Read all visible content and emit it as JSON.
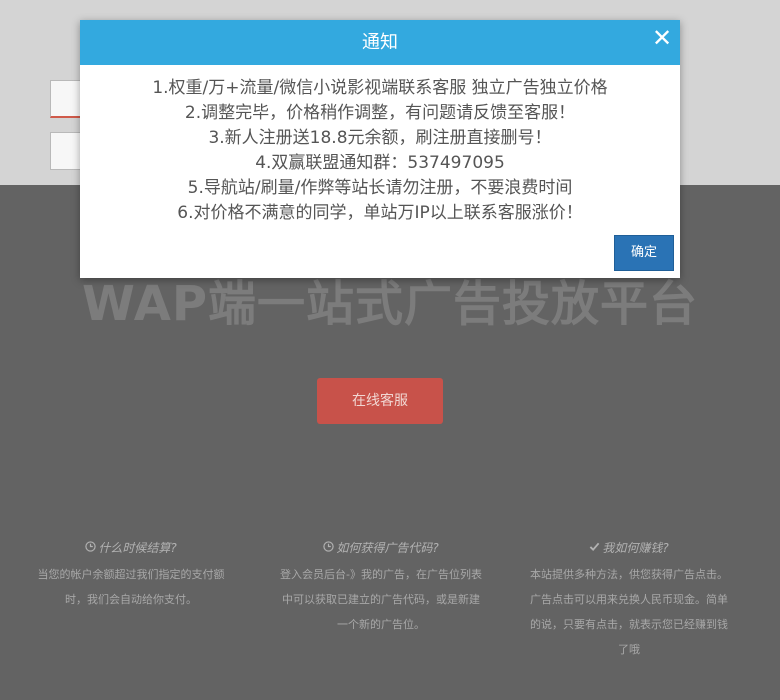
{
  "hero": {
    "title": "WAP端一站式广告投放平台",
    "cs_button_label": "在线客服"
  },
  "faq": [
    {
      "icon": "clock-icon",
      "question": "什么时候结算?",
      "answer_lines": [
        "当您的帐户余额超过我们指定的支付额",
        "时，我们会自动给你支付。"
      ]
    },
    {
      "icon": "clock-icon",
      "question": "如何获得广告代码?",
      "answer_lines": [
        "登入会员后台-》我的广告，在广告位列表",
        "中可以获取已建立的广告代码，或是新建",
        "一个新的广告位。"
      ]
    },
    {
      "icon": "check-icon",
      "question": "我如何赚钱?",
      "answer_lines": [
        "本站提供多种方法，供您获得广告点击。",
        "广告点击可以用来兑换人民币现金。简单",
        "的说，只要有点击，就表示您已经赚到钱",
        "了哦"
      ]
    }
  ],
  "modal": {
    "title": "通知",
    "close_glyph": "✕",
    "lines": [
      "1.权重/万+流量/微信小说影视端联系客服 独立广告独立价格",
      "2.调整完毕，价格稍作调整，有问题请反馈至客服！",
      "3.新人注册送18.8元余额，刷注册直接删号！",
      "4.双赢联盟通知群：537497095",
      "5.导航站/刷量/作弊等站长请勿注册，不要浪费时间",
      "6.对价格不满意的同学，单站万IP以上联系客服涨价！"
    ],
    "ok_label": "确定"
  },
  "colors": {
    "modal_header": "#33a9df",
    "ok_button": "#2a73b5",
    "cs_button": "#c8524a",
    "backdrop": "#636363"
  }
}
